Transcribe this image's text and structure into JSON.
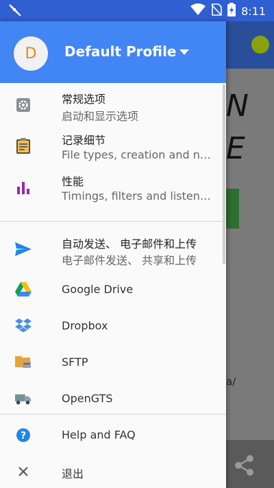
{
  "status_bar": {
    "time": "8:11"
  },
  "drawer": {
    "avatar_letter": "D",
    "profile_name": "Default Profile",
    "items": [
      {
        "title": "常规选项",
        "subtitle": "启动和显示选项",
        "icon": "gear-icon"
      },
      {
        "title": "记录细节",
        "subtitle": "File types, creation and naming",
        "icon": "clipboard-icon"
      },
      {
        "title": "性能",
        "subtitle": "Timings, filters and listeners",
        "icon": "bar-chart-icon"
      },
      {
        "title": "自动发送、 电子邮件和上传",
        "subtitle": "电子邮件发送、 共享和上传",
        "icon": "send-icon"
      },
      {
        "title": "Google Drive",
        "icon": "google-drive-icon"
      },
      {
        "title": "Dropbox",
        "icon": "dropbox-icon"
      },
      {
        "title": "SFTP",
        "icon": "sftp-folder-icon"
      },
      {
        "title": "OpenGTS",
        "icon": "truck-icon"
      },
      {
        "title": "Help and FAQ",
        "icon": "help-icon"
      },
      {
        "title": "退出",
        "icon": "close-icon"
      }
    ]
  },
  "background": {
    "big_text_1": "N",
    "big_text_2": "E",
    "url_fragment": "a/"
  },
  "colors": {
    "header": "#4285f4",
    "status_bar": "#2f5fd0",
    "avatar_text": "#e68a1a"
  }
}
